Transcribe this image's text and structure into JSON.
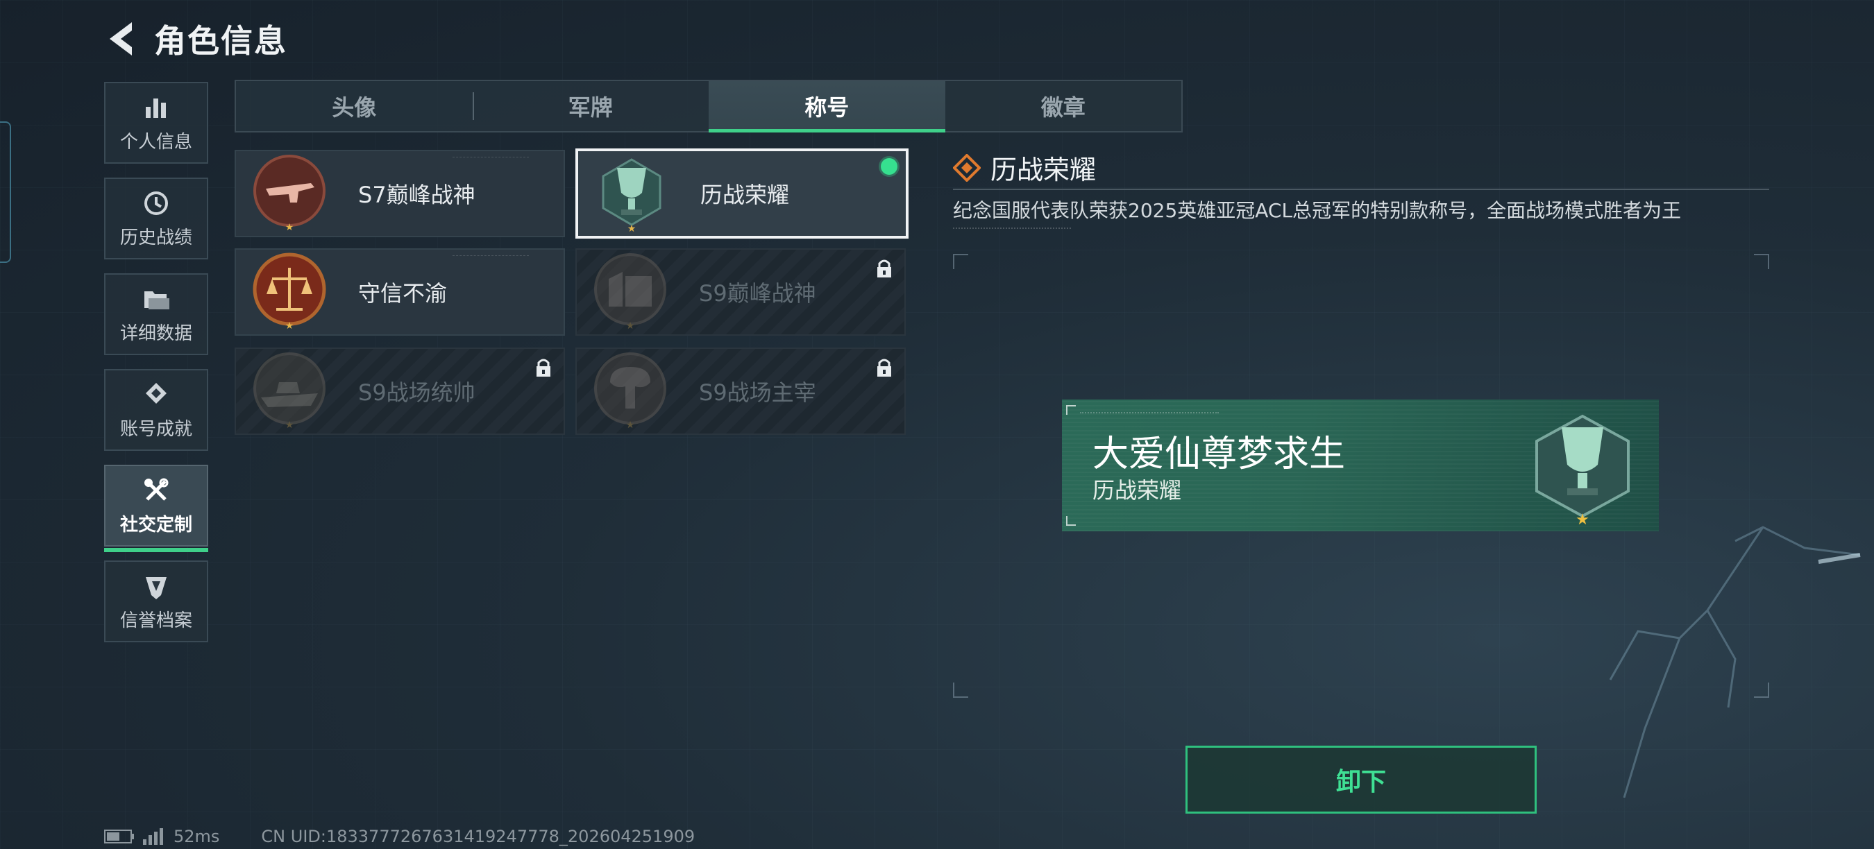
{
  "header": {
    "title": "角色信息"
  },
  "sidebar": {
    "items": [
      {
        "label": "个人信息",
        "icon": "bar-chart-icon"
      },
      {
        "label": "历史战绩",
        "icon": "history-clock-icon"
      },
      {
        "label": "详细数据",
        "icon": "folder-icon"
      },
      {
        "label": "账号成就",
        "icon": "achievement-medal-icon"
      },
      {
        "label": "社交定制",
        "icon": "tools-wrench-icon",
        "active": true
      },
      {
        "label": "信誉档案",
        "icon": "credit-shield-icon"
      }
    ]
  },
  "tabs": [
    {
      "label": "头像"
    },
    {
      "label": "军牌"
    },
    {
      "label": "称号",
      "active": true
    },
    {
      "label": "徽章"
    }
  ],
  "titles": [
    {
      "name": "S7巅峰战神",
      "locked": false,
      "emblem": "gun-emblem-icon"
    },
    {
      "name": "历战荣耀",
      "locked": false,
      "selected": true,
      "equipped": true,
      "emblem": "trophy-emblem-icon"
    },
    {
      "name": "守信不渝",
      "locked": false,
      "emblem": "scales-emblem-icon"
    },
    {
      "name": "S9巅峰战神",
      "locked": true,
      "emblem": "fortress-emblem-icon"
    },
    {
      "name": "S9战场统帅",
      "locked": true,
      "emblem": "warship-emblem-icon"
    },
    {
      "name": "S9战场主宰",
      "locked": true,
      "emblem": "mushroom-cloud-emblem-icon"
    }
  ],
  "detail": {
    "title": "历战荣耀",
    "description": "纪念国服代表队荣获2025英雄亚冠ACL总冠军的特别款称号，全面战场模式胜者为王",
    "preview": {
      "player_name": "大爱仙尊梦求生",
      "title": "历战荣耀"
    },
    "button_label": "卸下"
  },
  "status": {
    "ping": "52ms",
    "uid": "CN UID:1833777267631419247778_202604251909"
  },
  "colors": {
    "accent": "#3fd08a",
    "nameplate": "#2b6a58",
    "equipped": "#36e08f"
  }
}
